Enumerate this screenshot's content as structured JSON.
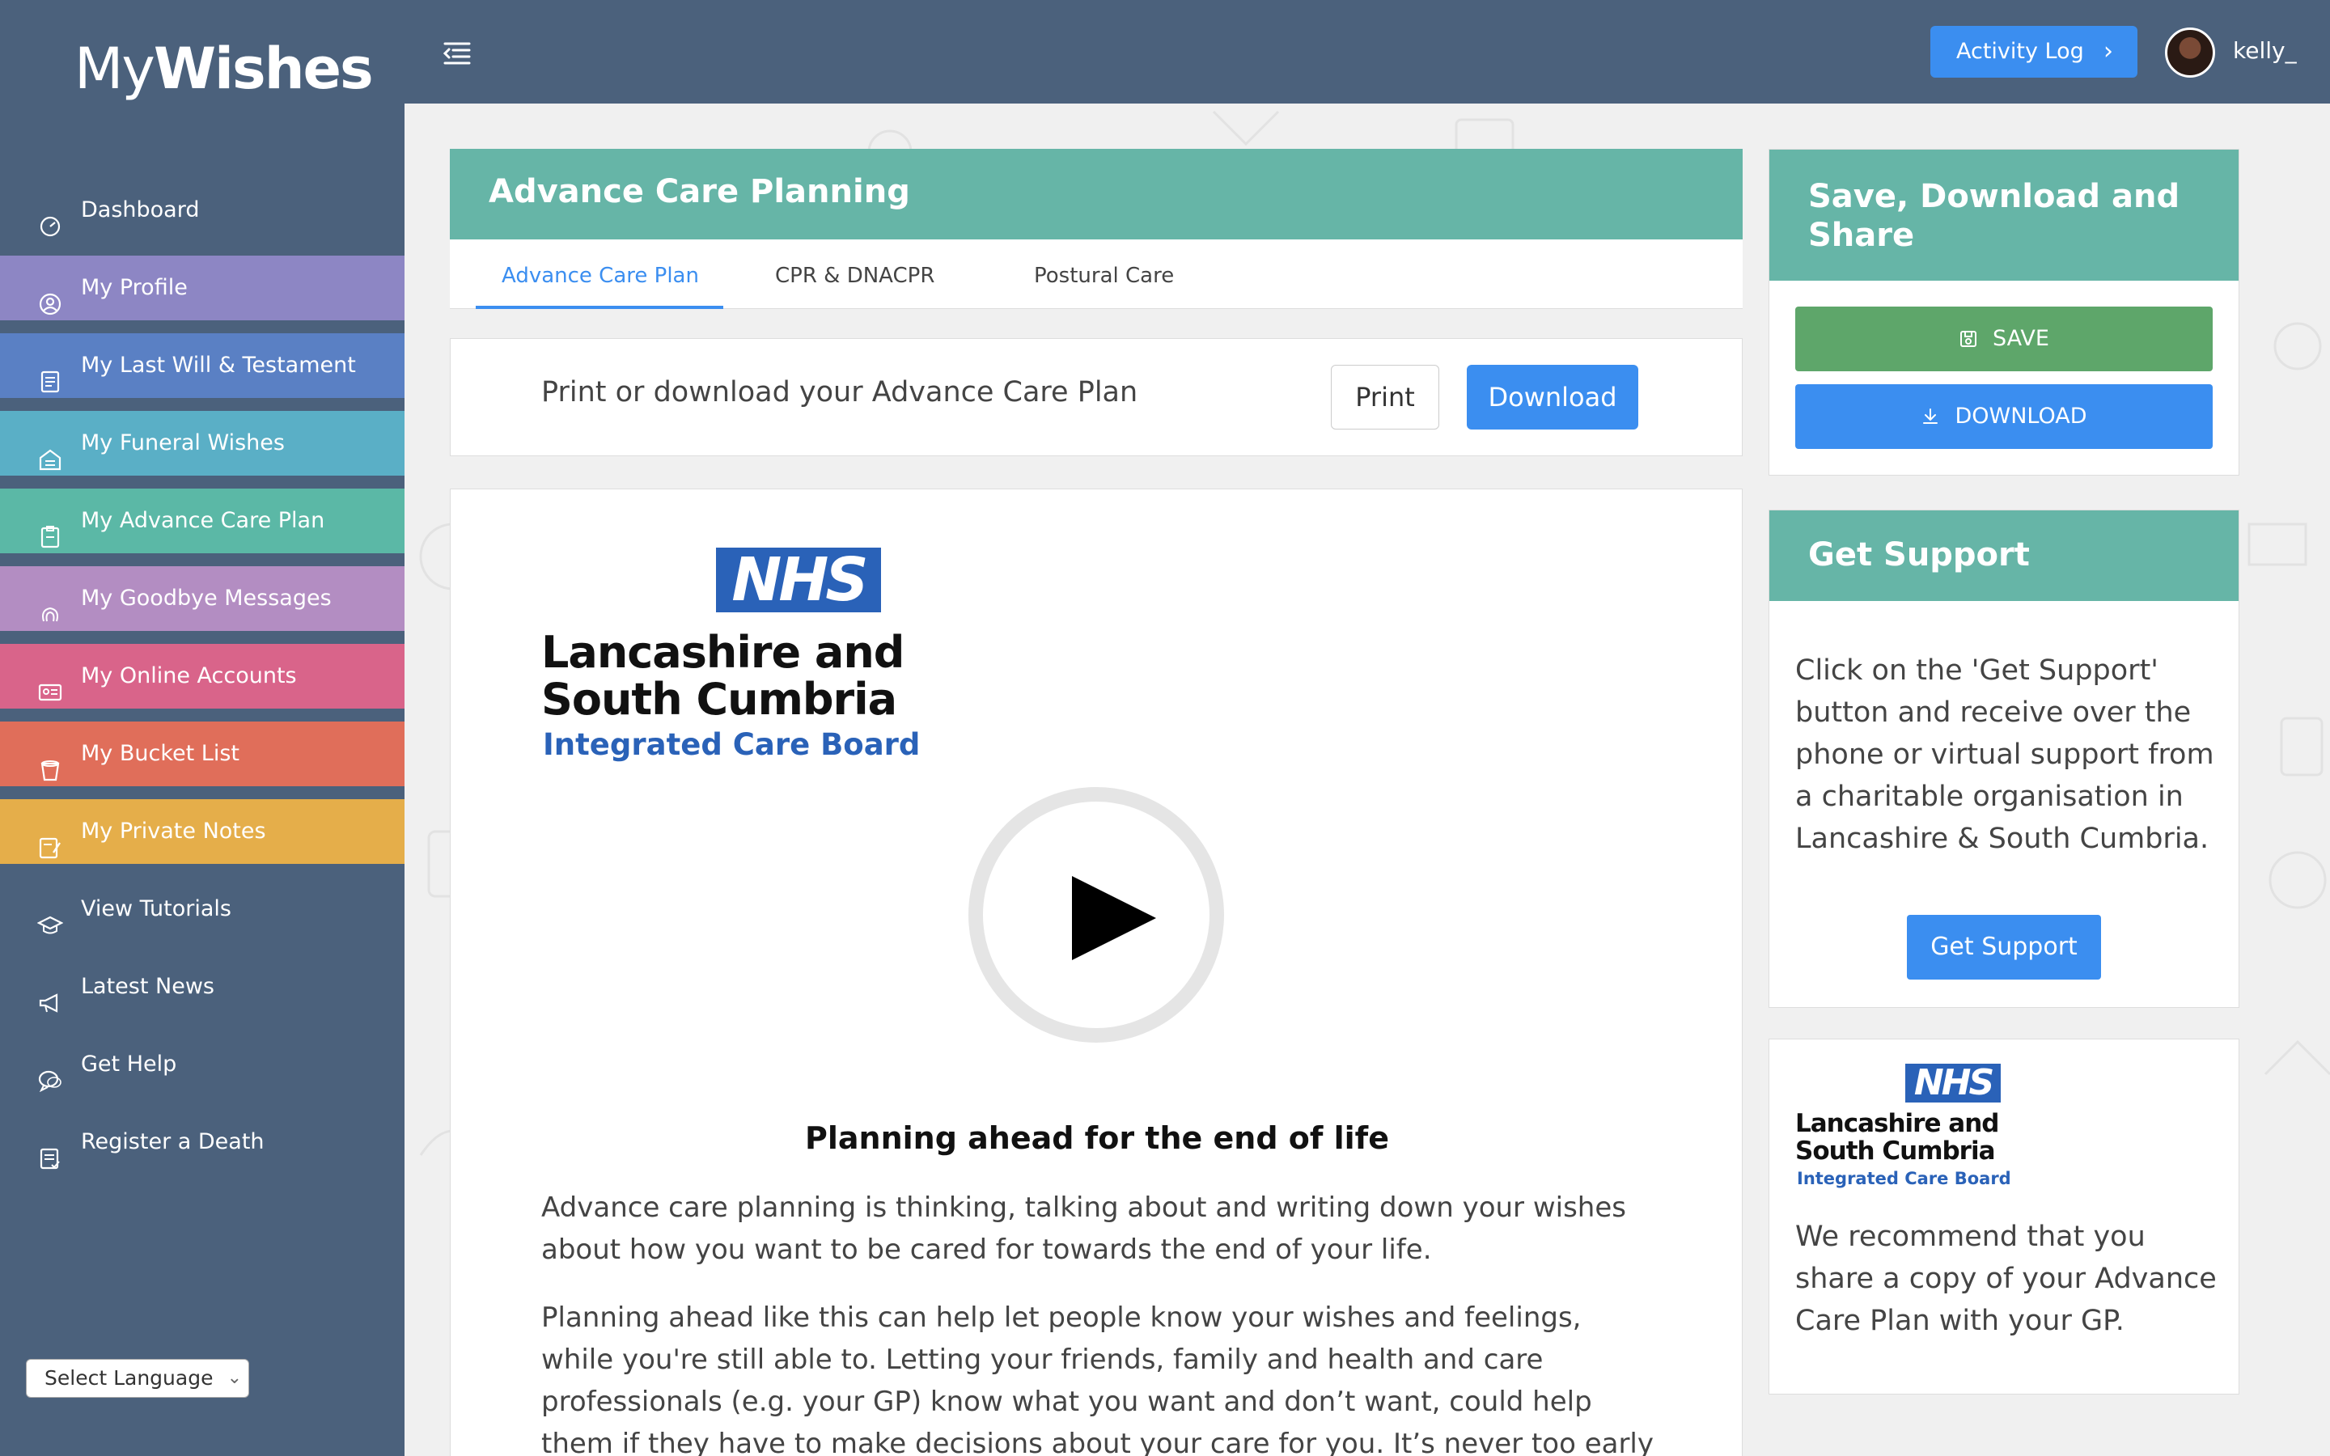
{
  "app": {
    "logo_part1": "My",
    "logo_part2": "Wishes",
    "activity_log": "Activity Log",
    "username": "kelly_"
  },
  "sidebar": {
    "items": [
      {
        "label": "Dashboard",
        "icon": "dashboard-icon",
        "color": "#4b617c"
      },
      {
        "label": "My Profile",
        "icon": "user-circle-icon",
        "color": "#8d86c4"
      },
      {
        "label": "My Last Will & Testament",
        "icon": "document-list-icon",
        "color": "#5a80c4"
      },
      {
        "label": "My Funeral Wishes",
        "icon": "building-icon",
        "color": "#5aafc6"
      },
      {
        "label": "My Advance Care Plan",
        "icon": "clipboard-icon",
        "color": "#5bb8a6"
      },
      {
        "label": "My Goodbye Messages",
        "icon": "fingerprint-icon",
        "color": "#b38dc2"
      },
      {
        "label": "My Online Accounts",
        "icon": "accounts-icon",
        "color": "#d9648a"
      },
      {
        "label": "My Bucket List",
        "icon": "bucket-icon",
        "color": "#e06e5a"
      },
      {
        "label": "My Private Notes",
        "icon": "notes-icon",
        "color": "#e5ae4a"
      },
      {
        "label": "View Tutorials",
        "icon": "graduation-cap-icon",
        "color": "#4b617c"
      },
      {
        "label": "Latest News",
        "icon": "megaphone-icon",
        "color": "#4b617c"
      },
      {
        "label": "Get Help",
        "icon": "chat-icon",
        "color": "#4b617c"
      },
      {
        "label": "Register a Death",
        "icon": "register-icon",
        "color": "#4b617c"
      }
    ],
    "language": "Select Language"
  },
  "main": {
    "title": "Advance Care Planning",
    "tabs": [
      {
        "label": "Advance Care Plan",
        "active": true
      },
      {
        "label": "CPR & DNACPR",
        "active": false
      },
      {
        "label": "Postural Care",
        "active": false
      }
    ],
    "print_prompt": "Print or download your Advance Care Plan",
    "print_label": "Print",
    "download_label": "Download",
    "nhs": {
      "badge": "NHS",
      "line1": "Lancashire and",
      "line2": "South Cumbria",
      "line3": "Integrated Care Board"
    },
    "article_heading": "Planning ahead for the end of life",
    "para1": "Advance care planning is thinking, talking about and writing down your wishes about how you want to be cared for towards the end of your life.",
    "para2": "Planning ahead like this can help let people know your wishes and feelings, while you're still able to. Letting your friends, family and health and care professionals (e.g. your GP) know what you want and don’t want, could help them if they have to make decisions about your care for you. It’s never too early to put this in place. It"
  },
  "right": {
    "save_title": "Save, Download and Share",
    "save_label": "SAVE",
    "download_label": "DOWNLOAD",
    "support_title": "Get Support",
    "support_text": "Click on the 'Get Support' button and receive over the phone or virtual support from a charitable organisation in Lancashire & South Cumbria.",
    "support_button": "Get Support",
    "share_text": "We recommend that you share a copy of your Advance Care Plan with your GP."
  },
  "colors": {
    "header": "#4b617c",
    "accent": "#3b8ef0",
    "teal": "#66b5a7",
    "save_green": "#5ea66a",
    "nhs_blue": "#2a62b8"
  }
}
